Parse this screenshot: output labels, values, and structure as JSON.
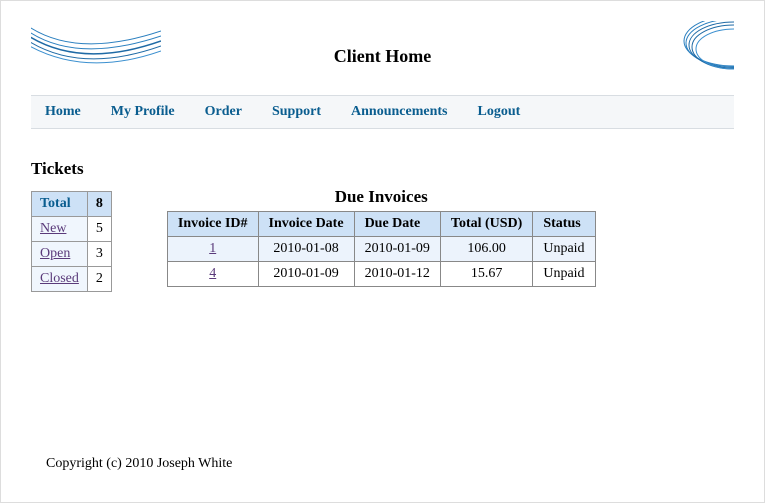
{
  "header": {
    "title": "Client Home"
  },
  "nav": {
    "home": "Home",
    "profile": "My Profile",
    "order": "Order",
    "support": "Support",
    "announcements": "Announcements",
    "logout": "Logout"
  },
  "tickets": {
    "heading": "Tickets",
    "total_label": "Total",
    "total_count": "8",
    "rows": [
      {
        "label": "New",
        "count": "5"
      },
      {
        "label": "Open",
        "count": "3"
      },
      {
        "label": "Closed",
        "count": "2"
      }
    ]
  },
  "invoices": {
    "heading": "Due Invoices",
    "columns": {
      "id": "Invoice ID#",
      "date": "Invoice Date",
      "due": "Due Date",
      "total": "Total (USD)",
      "status": "Status"
    },
    "rows": [
      {
        "id": "1",
        "date": "2010-01-08",
        "due": "2010-01-09",
        "total": "106.00",
        "status": "Unpaid"
      },
      {
        "id": "4",
        "date": "2010-01-09",
        "due": "2010-01-12",
        "total": "15.67",
        "status": "Unpaid"
      }
    ]
  },
  "footer": "Copyright (c) 2010 Joseph White"
}
